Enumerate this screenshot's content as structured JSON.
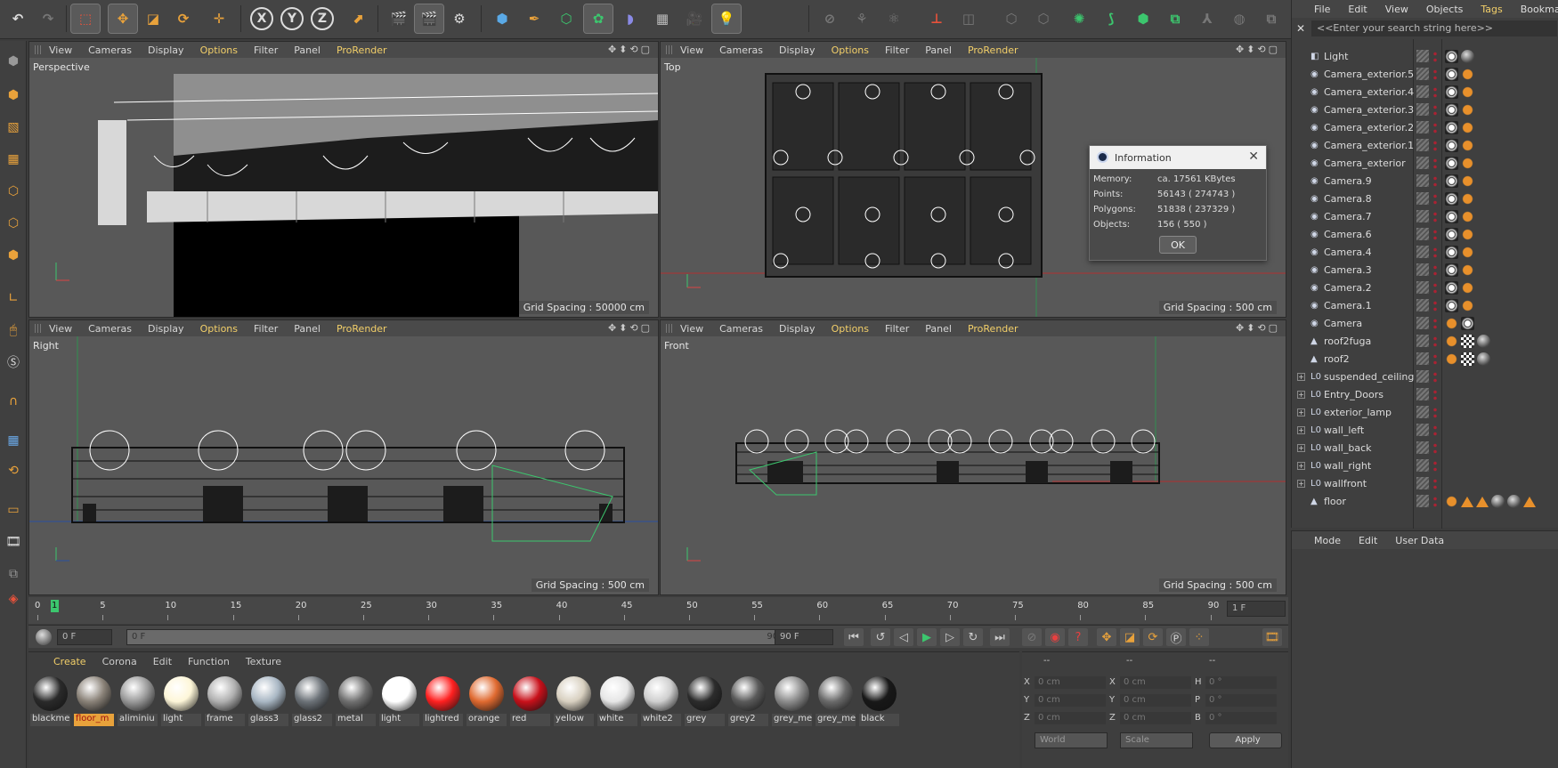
{
  "toolbar": {
    "axis_x": "X",
    "axis_y": "Y",
    "axis_z": "Z"
  },
  "viewports": [
    {
      "name": "Perspective",
      "grid": "Grid Spacing : 50000 cm"
    },
    {
      "name": "Top",
      "grid": "Grid Spacing : 500 cm"
    },
    {
      "name": "Right",
      "grid": "Grid Spacing : 500 cm"
    },
    {
      "name": "Front",
      "grid": "Grid Spacing : 500 cm"
    }
  ],
  "viewport_menu": [
    "View",
    "Cameras",
    "Display",
    "Options",
    "Filter",
    "Panel",
    "ProRender"
  ],
  "info_dialog": {
    "title": "Information",
    "rows": [
      {
        "label": "Memory:",
        "value": "ca. 17561 KBytes"
      },
      {
        "label": "Points:",
        "value": "56143 ( 274743 )"
      },
      {
        "label": "Polygons:",
        "value": "51838 ( 237329 )"
      },
      {
        "label": "Objects:",
        "value": "156 ( 550 )"
      }
    ],
    "ok_label": "OK"
  },
  "timeline": {
    "ticks": [
      "0",
      "5",
      "10",
      "15",
      "20",
      "25",
      "30",
      "35",
      "40",
      "45",
      "50",
      "55",
      "60",
      "65",
      "70",
      "75",
      "80",
      "85",
      "90"
    ],
    "current_frame": "1",
    "frame_field": "1 F"
  },
  "transport": {
    "start_field": "0 F",
    "range_start": "0 F",
    "range_end": "90 F",
    "end_field": "90 F"
  },
  "material_manager": {
    "tabs": [
      "Create",
      "Corona",
      "Edit",
      "Function",
      "Texture"
    ],
    "materials": [
      {
        "name": "blackme",
        "color": "#2a2a2a"
      },
      {
        "name": "floor_m",
        "color": "#8a8278"
      },
      {
        "name": "aliminiu",
        "color": "#9a9a9a"
      },
      {
        "name": "light",
        "color": "#fdf6d8"
      },
      {
        "name": "frame",
        "color": "#b0b0b0"
      },
      {
        "name": "glass3",
        "color": "#a9b7c4"
      },
      {
        "name": "glass2",
        "color": "#6c7278"
      },
      {
        "name": "metal",
        "color": "#707070"
      },
      {
        "name": "light",
        "color": "#ffffff"
      },
      {
        "name": "lightred",
        "color": "#ff2020"
      },
      {
        "name": "orange",
        "color": "#e06a30"
      },
      {
        "name": "red",
        "color": "#c8101a"
      },
      {
        "name": "yellow",
        "color": "#d8d0c0"
      },
      {
        "name": "white",
        "color": "#e6e6e6"
      },
      {
        "name": "white2",
        "color": "#cfcfcf"
      },
      {
        "name": "grey",
        "color": "#2c2c2c"
      },
      {
        "name": "grey2",
        "color": "#5a5a5a"
      },
      {
        "name": "grey_me",
        "color": "#8c8c8c"
      },
      {
        "name": "grey_me",
        "color": "#6a6a6a"
      },
      {
        "name": "black",
        "color": "#181818"
      }
    ]
  },
  "coordinates": {
    "headers": [
      "--",
      "--",
      "--"
    ],
    "pos_labels": [
      "X",
      "Y",
      "Z"
    ],
    "size_labels": [
      "X",
      "Y",
      "Z"
    ],
    "rot_labels": [
      "H",
      "P",
      "B"
    ],
    "pos_values": [
      "0 cm",
      "0 cm",
      "0 cm"
    ],
    "size_values": [
      "0 cm",
      "0 cm",
      "0 cm"
    ],
    "rot_values": [
      "0 °",
      "0 °",
      "0 °"
    ],
    "mode_world": "World",
    "mode_scale": "Scale",
    "apply_label": "Apply"
  },
  "object_manager": {
    "menu": [
      "File",
      "Edit",
      "View",
      "Objects",
      "Tags",
      "Bookmarks"
    ],
    "search_placeholder": "<<Enter your search string here>>",
    "objects": [
      {
        "name": "Light",
        "icon": "light-icon",
        "tags": [
          "cam",
          "mat1"
        ]
      },
      {
        "name": "Camera_exterior.5",
        "icon": "camera-icon",
        "tags": [
          "cam",
          "org"
        ]
      },
      {
        "name": "Camera_exterior.4",
        "icon": "camera-icon",
        "tags": [
          "cam",
          "org"
        ]
      },
      {
        "name": "Camera_exterior.3",
        "icon": "camera-icon",
        "tags": [
          "cam",
          "org"
        ]
      },
      {
        "name": "Camera_exterior.2",
        "icon": "camera-icon",
        "tags": [
          "cam",
          "org"
        ]
      },
      {
        "name": "Camera_exterior.1",
        "icon": "camera-icon",
        "tags": [
          "cam",
          "org"
        ]
      },
      {
        "name": "Camera_exterior",
        "icon": "camera-icon",
        "tags": [
          "cam",
          "org"
        ]
      },
      {
        "name": "Camera.9",
        "icon": "camera-icon",
        "tags": [
          "cam",
          "org"
        ]
      },
      {
        "name": "Camera.8",
        "icon": "camera-icon",
        "tags": [
          "cam",
          "org"
        ]
      },
      {
        "name": "Camera.7",
        "icon": "camera-icon",
        "tags": [
          "cam",
          "org"
        ]
      },
      {
        "name": "Camera.6",
        "icon": "camera-icon",
        "tags": [
          "cam",
          "org"
        ]
      },
      {
        "name": "Camera.4",
        "icon": "camera-icon",
        "tags": [
          "cam",
          "org"
        ]
      },
      {
        "name": "Camera.3",
        "icon": "camera-icon",
        "tags": [
          "cam",
          "org"
        ]
      },
      {
        "name": "Camera.2",
        "icon": "camera-icon",
        "tags": [
          "cam",
          "org"
        ]
      },
      {
        "name": "Camera.1",
        "icon": "camera-icon",
        "tags": [
          "cam",
          "org"
        ]
      },
      {
        "name": "Camera",
        "icon": "camera-icon",
        "tags": [
          "org",
          "cam"
        ]
      },
      {
        "name": "roof2fuga",
        "icon": "polygon-icon",
        "tags": [
          "org",
          "chk",
          "mat1"
        ]
      },
      {
        "name": "roof2",
        "icon": "polygon-icon",
        "tags": [
          "org",
          "chk",
          "mat1"
        ]
      },
      {
        "name": "suspended_ceiling",
        "icon": "null-icon",
        "tags": [],
        "expand": true
      },
      {
        "name": "Entry_Doors",
        "icon": "null-icon",
        "tags": [],
        "expand": true
      },
      {
        "name": "exterior_lamp",
        "icon": "null-icon",
        "tags": [],
        "expand": true
      },
      {
        "name": "wall_left",
        "icon": "null-icon",
        "tags": [],
        "expand": true
      },
      {
        "name": "wall_back",
        "icon": "null-icon",
        "tags": [],
        "expand": true
      },
      {
        "name": "wall_right",
        "icon": "null-icon",
        "tags": [],
        "expand": true
      },
      {
        "name": "wallfront",
        "icon": "null-icon",
        "tags": [],
        "expand": true
      },
      {
        "name": "floor",
        "icon": "polygon-icon",
        "tags": [
          "org",
          "tri",
          "tri",
          "mat1",
          "mat1",
          "tri"
        ]
      }
    ]
  },
  "attribute_manager": {
    "menu": [
      "Mode",
      "Edit",
      "User Data"
    ]
  }
}
